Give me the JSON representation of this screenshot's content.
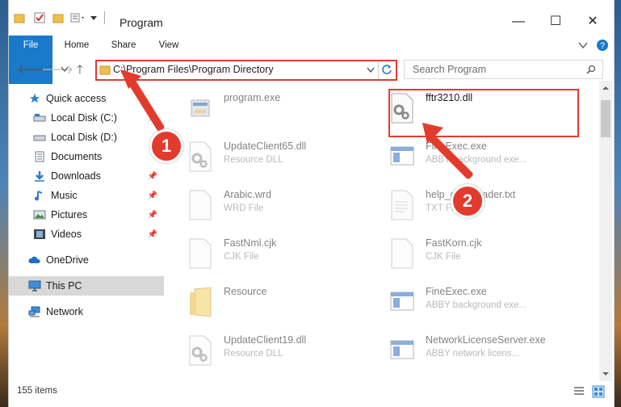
{
  "window": {
    "title": "Program",
    "controls": {
      "minimize": "—",
      "maximize": "☐",
      "close": "✕"
    }
  },
  "ribbon": {
    "tabs": [
      "File",
      "Home",
      "Share",
      "View"
    ]
  },
  "address": {
    "path": "C:\\Program Files\\Program Directory",
    "search_placeholder": "Search Program"
  },
  "nav": {
    "items": [
      {
        "label": "Quick access",
        "icon": "star-icon"
      },
      {
        "label": "Local Disk (C:)",
        "icon": "drive-icon"
      },
      {
        "label": "Local Disk (D:)",
        "icon": "drive-icon"
      },
      {
        "label": "Documents",
        "icon": "documents-icon"
      },
      {
        "label": "Downloads",
        "icon": "downloads-icon"
      },
      {
        "label": "Music",
        "icon": "music-icon"
      },
      {
        "label": "Pictures",
        "icon": "pictures-icon"
      },
      {
        "label": "Videos",
        "icon": "videos-icon"
      },
      {
        "label": "OneDrive",
        "icon": "cloud-icon"
      },
      {
        "label": "This PC",
        "icon": "computer-icon"
      },
      {
        "label": "Network",
        "icon": "network-icon"
      }
    ]
  },
  "files": [
    {
      "name": "program.exe",
      "type": "",
      "icon": "exe-icon"
    },
    {
      "name": "fftr3210.dll",
      "type": "",
      "icon": "dll-gear-icon"
    },
    {
      "name": "UpdateClient65.dll",
      "type": "Resource DLL",
      "icon": "dll-gear-icon"
    },
    {
      "name": "FineExec.exe",
      "type": "ABBY background exe...",
      "icon": "window-exe-icon"
    },
    {
      "name": "Arabic.wrd",
      "type": "WRD File",
      "icon": "blank-file-icon"
    },
    {
      "name": "help_downloader.txt",
      "type": "TXT File",
      "icon": "text-file-icon"
    },
    {
      "name": "FastNml.cjk",
      "type": "CJK File",
      "icon": "blank-file-icon"
    },
    {
      "name": "FastKorn.cjk",
      "type": "CJK File",
      "icon": "blank-file-icon"
    },
    {
      "name": "Resource",
      "type": "",
      "icon": "folder-icon"
    },
    {
      "name": "FineExec.exe",
      "type": "ABBY background exe...",
      "icon": "window-exe-icon"
    },
    {
      "name": "UpdateClient19.dll",
      "type": "Resource DLL",
      "icon": "dll-gear-icon"
    },
    {
      "name": "NetworkLicenseServer.exe",
      "type": "ABBY network licens...",
      "icon": "window-exe-icon"
    }
  ],
  "status": {
    "count": "155 items"
  },
  "annotations": {
    "step1": "1",
    "step2": "2",
    "color": "#e23b2e"
  }
}
